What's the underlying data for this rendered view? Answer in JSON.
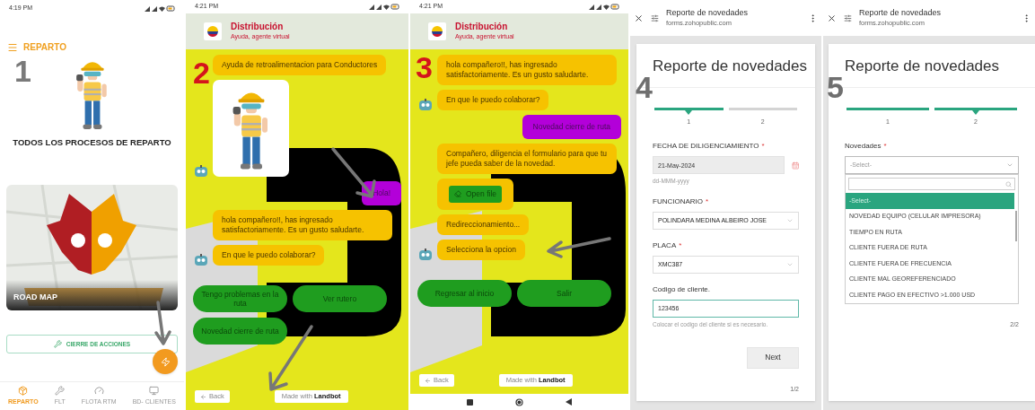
{
  "panels": [
    {
      "kind": "app",
      "step_mark": {
        "text": "1",
        "color": "#7a7a7a"
      },
      "status_time": "4:19 PM",
      "title": "REPARTO",
      "headline": "TODOS LOS PROCESOS DE REPARTO",
      "card_title": "ROAD MAP",
      "action_button": "CIERRE DE ACCIONES",
      "nav": [
        {
          "label": "REPARTO",
          "selected": true
        },
        {
          "label": "FLT",
          "selected": false
        },
        {
          "label": "FLOTA RTM",
          "selected": false
        },
        {
          "label": "BD- CLIENTES",
          "selected": false
        }
      ]
    },
    {
      "kind": "chat",
      "step_mark": {
        "text": "2",
        "color": "#d4141c"
      },
      "status_time": "4:21 PM",
      "title": "Distribución",
      "subtitle": "Ayuda, agente virtual",
      "messages": [
        {
          "kind": "bot",
          "text": "Ayuda de retroalimentacion para Conductores",
          "avatar": false
        },
        {
          "kind": "image",
          "avatar": true
        },
        {
          "kind": "user",
          "text": "Hola!"
        },
        {
          "kind": "bot",
          "text": "hola compañero!!, has ingresado satisfactoriamente. Es un gusto saludarte.",
          "avatar": false
        },
        {
          "kind": "bot",
          "text": "En que le puedo colaborar?",
          "avatar": true
        }
      ],
      "choices": [
        "Tengo problemas en la ruta",
        "Ver rutero",
        "Novedad cierre de ruta"
      ],
      "back_button": "Back",
      "credit": "Made with **Landbot**",
      "system_nav": false
    },
    {
      "kind": "chat",
      "step_mark": {
        "text": "3",
        "color": "#d4141c"
      },
      "status_time": "4:21 PM",
      "title": "Distribución",
      "subtitle": "Ayuda, agente virtual",
      "messages": [
        {
          "kind": "bot",
          "text": "hola compañero!!, has ingresado satisfactoriamente. Es un gusto saludarte.",
          "avatar": false
        },
        {
          "kind": "bot",
          "text": "En que le puedo colaborar?",
          "avatar": true
        },
        {
          "kind": "user",
          "text": "Novedad cierre de ruta"
        },
        {
          "kind": "bot",
          "text": "Compañero, diligencia el formulario para que tu jefe pueda saber de la novedad.",
          "avatar": false
        },
        {
          "kind": "file",
          "button": "Open file",
          "avatar": false
        },
        {
          "kind": "bot",
          "text": "Redireccionamiento...",
          "avatar": false
        },
        {
          "kind": "bot",
          "text": "Selecciona la opcion",
          "avatar": true
        }
      ],
      "choices": [
        "Regresar al inicio",
        "Salir"
      ],
      "back_button": "Back",
      "credit": "Made with **Landbot**",
      "system_nav": true
    },
    {
      "kind": "form",
      "step_mark": {
        "text": "4",
        "color": "#6f6f6f"
      },
      "header_title": "Reporte de novedades",
      "header_url": "forms.zohopublic.com",
      "title": "Reporte de novedades",
      "steps": [
        {
          "label": "1",
          "done": true,
          "selected": true
        },
        {
          "label": "2",
          "done": false,
          "selected": false
        }
      ],
      "fields": [
        {
          "kind": "date",
          "label": "FECHA DE DILIGENCIAMIENTO",
          "required_mark": "*",
          "value": "21-May-2024",
          "hint": "dd-MMM-yyyy"
        },
        {
          "kind": "select",
          "label": "FUNCIONARIO",
          "required_mark": "*",
          "value": "POLINDARA MEDINA ALBEIRO JOSE"
        },
        {
          "kind": "select",
          "label": "PLACA",
          "required_mark": "*",
          "value": "XMC387"
        },
        {
          "kind": "text",
          "label": "Codigo de cliente.",
          "value": "123456",
          "focused": true,
          "hint": "Colocar el codigo del cliente si es necesario."
        }
      ],
      "next_button": "Next",
      "page_indicator": "1/2"
    },
    {
      "kind": "form",
      "step_mark": {
        "text": "5",
        "color": "#6f6f6f"
      },
      "header_title": "Reporte de novedades",
      "header_url": "forms.zohopublic.com",
      "title": "Reporte de novedades",
      "steps": [
        {
          "label": "1",
          "done": true,
          "selected": false
        },
        {
          "label": "2",
          "done": true,
          "selected": true
        }
      ],
      "fields": [
        {
          "kind": "select",
          "label": "Novedades",
          "required_mark": "*",
          "placeholder": "-Select-",
          "open": true,
          "options": [
            {
              "label": "-Select-",
              "selected": true
            },
            {
              "label": "NOVEDAD EQUIPO (CELULAR IMPRESORA)",
              "selected": false
            },
            {
              "label": "TIEMPO EN RUTA",
              "selected": false
            },
            {
              "label": "CLIENTE FUERA DE RUTA",
              "selected": false
            },
            {
              "label": "CLIENTE FUERA DE FRECUENCIA",
              "selected": false
            },
            {
              "label": "CLIENTE MAL GEOREFERENCIADO",
              "selected": false
            },
            {
              "label": "CLIENTE PAGO EN EFECTIVO >1.000 USD",
              "selected": false
            }
          ]
        }
      ],
      "page_indicator": "2/2"
    }
  ]
}
